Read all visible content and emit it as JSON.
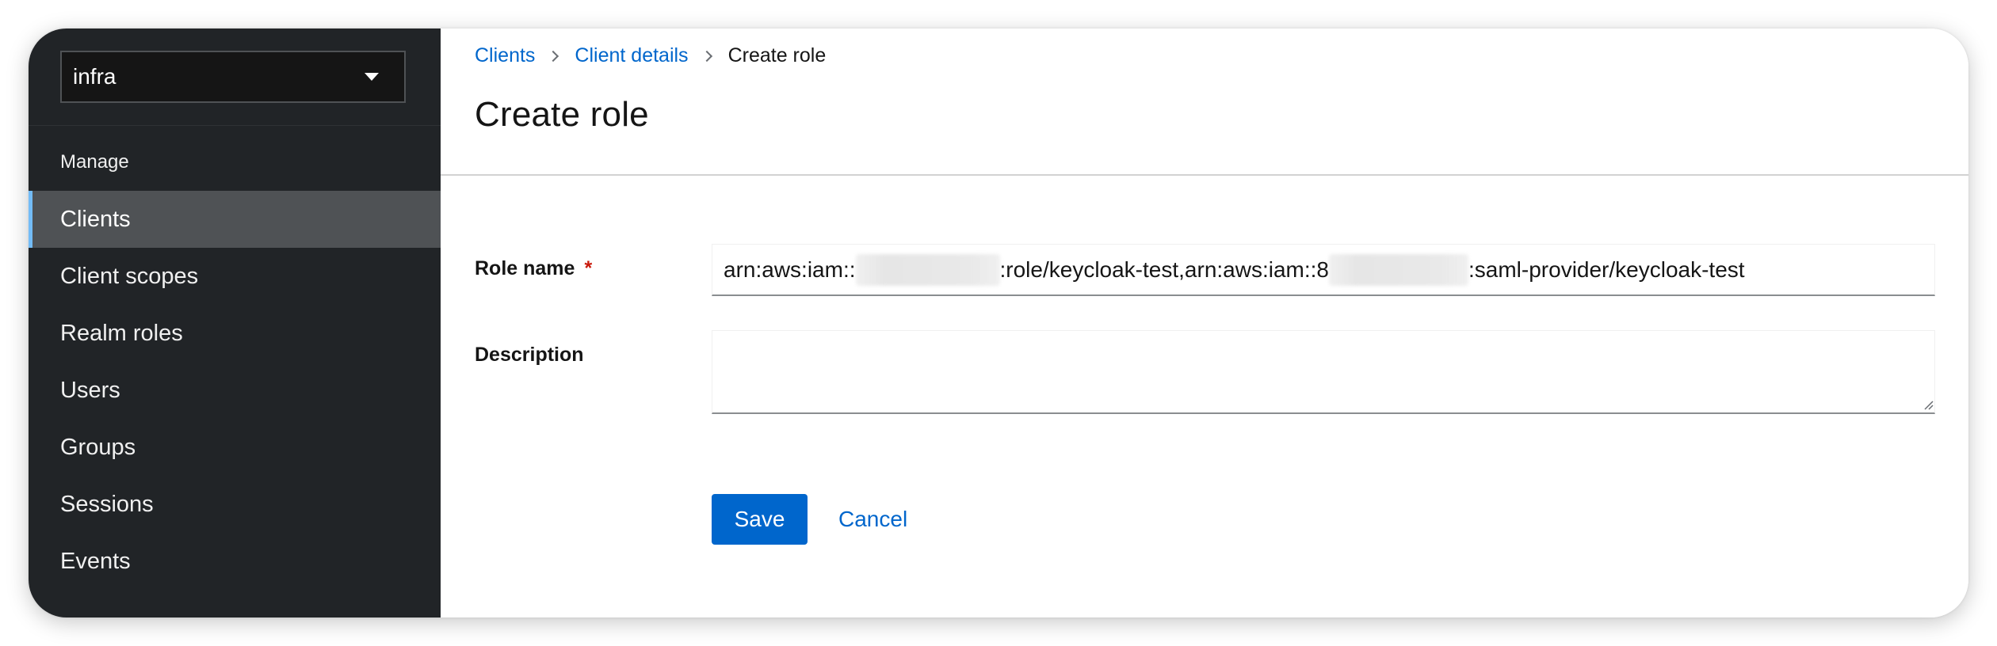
{
  "sidebar": {
    "realm_selector": {
      "value": "infra",
      "icon": "caret-down-icon"
    },
    "section_title": "Manage",
    "items": [
      {
        "label": "Clients",
        "active": true
      },
      {
        "label": "Client scopes",
        "active": false
      },
      {
        "label": "Realm roles",
        "active": false
      },
      {
        "label": "Users",
        "active": false
      },
      {
        "label": "Groups",
        "active": false
      },
      {
        "label": "Sessions",
        "active": false
      },
      {
        "label": "Events",
        "active": false
      }
    ]
  },
  "breadcrumb": {
    "items": [
      "Clients",
      "Client details"
    ],
    "current": "Create role"
  },
  "page": {
    "title": "Create role"
  },
  "form": {
    "role_name": {
      "label": "Role name",
      "required_marker": "*",
      "value_parts": [
        "arn:aws:iam::",
        ":role/keycloak-test,arn:aws:iam::8",
        ":saml-provider/keycloak-test"
      ]
    },
    "description": {
      "label": "Description",
      "value": ""
    }
  },
  "actions": {
    "save_label": "Save",
    "cancel_label": "Cancel"
  },
  "colors": {
    "sidebar_bg": "#212427",
    "active_item_bg": "#4f5255",
    "active_indicator": "#73bcf7",
    "link": "#0066cc",
    "primary_button": "#0066cc",
    "required": "#c9190b"
  }
}
